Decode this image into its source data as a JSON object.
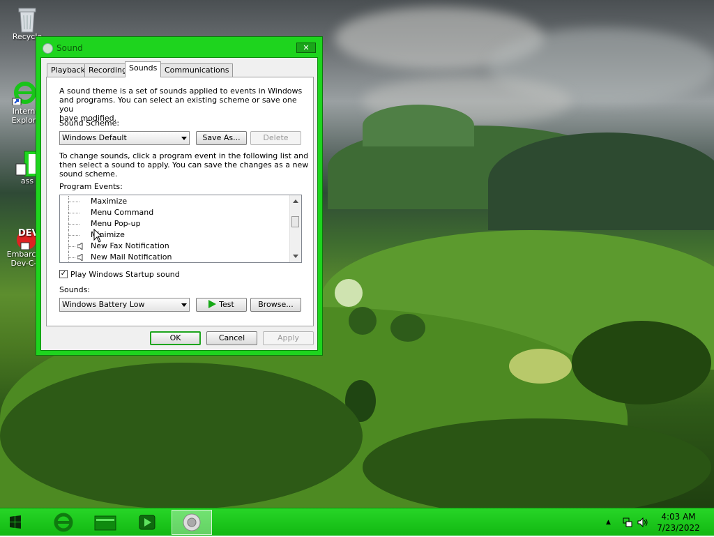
{
  "desktop_icons": [
    {
      "label": "Recycle",
      "icon": "recycle-bin-icon"
    },
    {
      "label": "Intern",
      "label2": "Explor",
      "icon": "internet-explorer-icon"
    },
    {
      "label": "ass",
      "icon": "folder-icon"
    },
    {
      "label": "Embarca",
      "label2": "Dev-C-",
      "icon": "devcpp-icon",
      "overlay": "DEV"
    }
  ],
  "window": {
    "title": "Sound",
    "close_glyph": "✕",
    "tabs": [
      {
        "label": "Playback"
      },
      {
        "label": "Recording"
      },
      {
        "label": "Sounds",
        "active": true
      },
      {
        "label": "Communications"
      }
    ],
    "sounds_tab": {
      "intro_lines": [
        "A sound theme is a set of sounds applied to events in Windows",
        "and programs.  You can select an existing scheme or save one you",
        "have modified."
      ],
      "scheme_label": "Sound Scheme:",
      "scheme_value": "Windows Default",
      "save_as_label": "Save As...",
      "delete_label": "Delete",
      "change_lines": [
        "To change sounds, click a program event in the following list and",
        "then select a sound to apply.  You can save the changes as a new",
        "sound scheme."
      ],
      "events_label": "Program Events:",
      "events": [
        {
          "name": "Maximize",
          "has_sound": false
        },
        {
          "name": "Menu Command",
          "has_sound": false
        },
        {
          "name": "Menu Pop-up",
          "has_sound": false
        },
        {
          "name": "Minimize",
          "has_sound": false
        },
        {
          "name": "New Fax Notification",
          "has_sound": true
        },
        {
          "name": "New Mail Notification",
          "has_sound": true
        }
      ],
      "startup_label": "Play Windows Startup sound",
      "startup_checked": true,
      "sounds_label": "Sounds:",
      "sound_value": "Windows Battery Low",
      "test_label": "Test",
      "browse_label": "Browse..."
    },
    "ok_label": "OK",
    "cancel_label": "Cancel",
    "apply_label": "Apply"
  },
  "taskbar": {
    "time": "4:03 AM",
    "date": "7/23/2022",
    "accent": "#1ec81e"
  }
}
